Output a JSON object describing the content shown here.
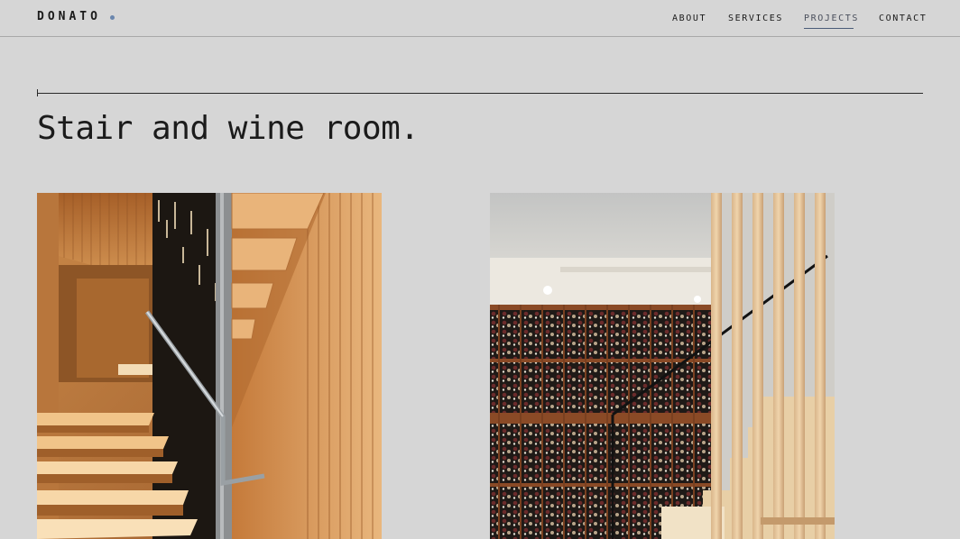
{
  "brand": {
    "name": "DONATO",
    "dot_color": "#6a86ad"
  },
  "nav": {
    "items": [
      {
        "label": "ABOUT",
        "active": false
      },
      {
        "label": "SERVICES",
        "active": false
      },
      {
        "label": "PROJECTS",
        "active": true
      },
      {
        "label": "CONTACT",
        "active": false
      }
    ],
    "active_underline_color": "#4a5b78"
  },
  "page": {
    "title": "Stair and wine room."
  },
  "gallery": {
    "images": [
      {
        "subject": "wooden-staircase-with-black-screen"
      },
      {
        "subject": "wine-cellar-with-wood-slat-screen"
      }
    ]
  },
  "colors": {
    "background": "#d6d6d6",
    "text": "#1b1b1b",
    "rule": "#2a2a2a"
  }
}
